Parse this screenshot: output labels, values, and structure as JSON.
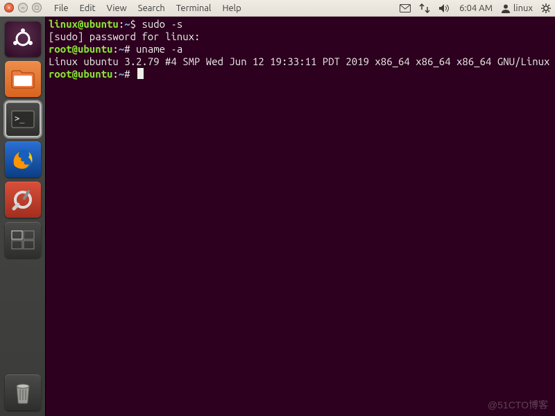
{
  "menubar": {
    "items": [
      "File",
      "Edit",
      "View",
      "Search",
      "Terminal",
      "Help"
    ],
    "time": "6:04 AM",
    "username": "linux"
  },
  "launcher": {
    "items": [
      {
        "name": "dash",
        "label": "Dash Home"
      },
      {
        "name": "files",
        "label": "Files"
      },
      {
        "name": "terminal",
        "label": "Terminal",
        "active": true
      },
      {
        "name": "firefox",
        "label": "Firefox"
      },
      {
        "name": "settings",
        "label": "System Settings"
      },
      {
        "name": "workspace",
        "label": "Workspace Switcher"
      }
    ],
    "trash": {
      "label": "Trash"
    }
  },
  "terminal": {
    "lines": [
      {
        "prompt_user": "linux@ubuntu",
        "prompt_path": "~",
        "symbol": "$",
        "command": "sudo -s"
      },
      {
        "plain": "[sudo] password for linux:"
      },
      {
        "prompt_user": "root@ubuntu",
        "prompt_path": "~",
        "symbol": "#",
        "command": "uname -a"
      },
      {
        "plain": "Linux ubuntu 3.2.79 #4 SMP Wed Jun 12 19:33:11 PDT 2019 x86_64 x86_64 x86_64 GNU/Linux"
      },
      {
        "prompt_user": "root@ubuntu",
        "prompt_path": "~",
        "symbol": "#",
        "command": "",
        "cursor": true
      }
    ]
  },
  "watermark": "@51CTO博客"
}
